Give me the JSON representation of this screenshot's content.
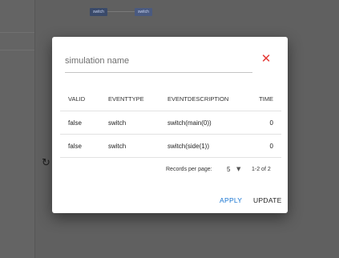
{
  "background": {
    "nodes": [
      "switch",
      "switch"
    ],
    "rotate_icon": "rotate-icon"
  },
  "dialog": {
    "name_placeholder": "simulation name",
    "close_icon": "close-icon",
    "close_color": "#e53935",
    "table": {
      "headers": [
        "VALID",
        "EVENTTYPE",
        "EVENTDESCRIPTION",
        "TIME"
      ],
      "rows": [
        {
          "valid": "false",
          "eventtype": "switch",
          "eventdescription": "switch(main(0))",
          "time": "0"
        },
        {
          "valid": "false",
          "eventtype": "switch",
          "eventdescription": "switch(side(1))",
          "time": "0"
        }
      ]
    },
    "pagination": {
      "rows_per_page_label": "Records per page:",
      "rows_per_page_value": "5",
      "range_text": "1-2 of 2"
    },
    "actions": {
      "apply_label": "APPLY",
      "update_label": "UPDATE",
      "apply_color": "#1976d2"
    }
  }
}
